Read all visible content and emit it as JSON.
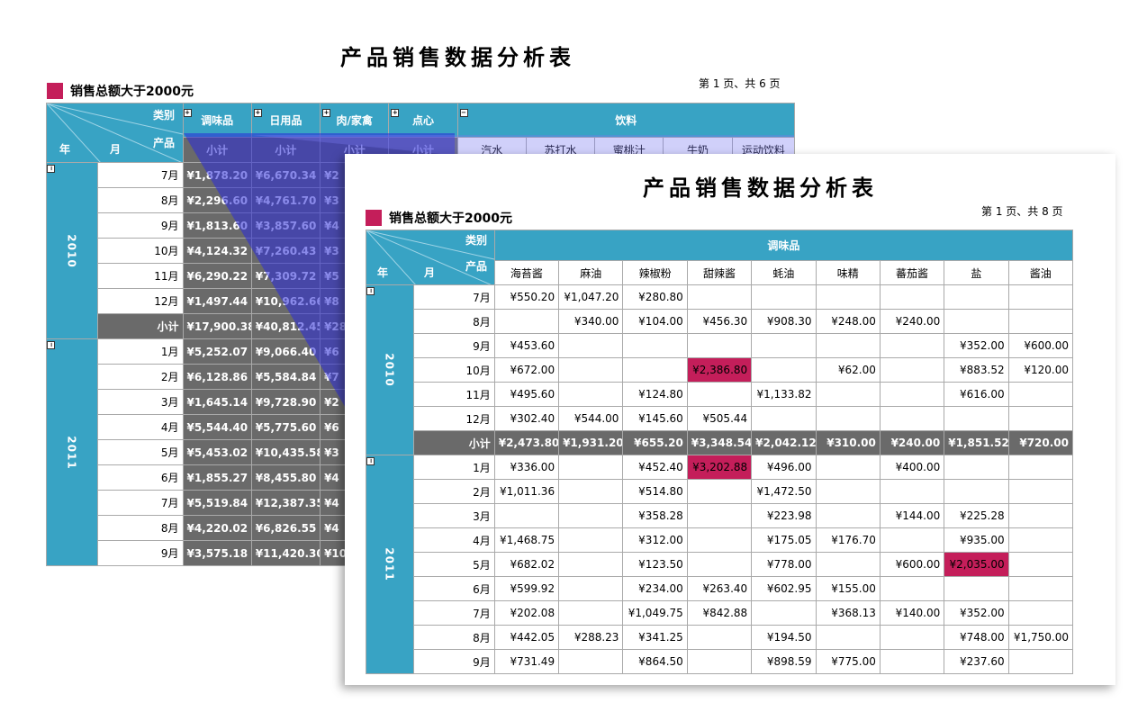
{
  "back": {
    "title": "产品销售数据分析表",
    "page_info": "第 1 页、共 6 页",
    "subtitle": "销售总额大于2000元",
    "corner": {
      "category": "类别",
      "product": "产品",
      "year": "年",
      "month": "月"
    },
    "categories": [
      "调味品",
      "日用品",
      "肉/家禽",
      "点心",
      "饮料"
    ],
    "subtotal_label": "小计",
    "drink_items": [
      "汽水",
      "苏打水",
      "蜜桃汁",
      "牛奶",
      "运动饮料"
    ],
    "years": [
      {
        "year": "2010",
        "rows": [
          {
            "month": "7月",
            "v1": "¥1,878.20",
            "v2": "¥6,670.34",
            "v3": "¥2"
          },
          {
            "month": "8月",
            "v1": "¥2,296.60",
            "v2": "¥4,761.70",
            "v3": "¥3"
          },
          {
            "month": "9月",
            "v1": "¥1,813.60",
            "v2": "¥3,857.60",
            "v3": "¥4"
          },
          {
            "month": "10月",
            "v1": "¥4,124.32",
            "v2": "¥7,260.43",
            "v3": "¥3"
          },
          {
            "month": "11月",
            "v1": "¥6,290.22",
            "v2": "¥7,309.72",
            "v3": "¥5"
          },
          {
            "month": "12月",
            "v1": "¥1,497.44",
            "v2": "¥10,962.66",
            "v3": "¥8"
          }
        ],
        "subtotal": {
          "label": "小计",
          "v1": "¥17,900.38",
          "v2": "¥40,812.45",
          "v3": "¥28"
        }
      },
      {
        "year": "2011",
        "rows": [
          {
            "month": "1月",
            "v1": "¥5,252.07",
            "v2": "¥9,066.40",
            "v3": "¥6"
          },
          {
            "month": "2月",
            "v1": "¥6,128.86",
            "v2": "¥5,584.84",
            "v3": "¥7"
          },
          {
            "month": "3月",
            "v1": "¥1,645.14",
            "v2": "¥9,728.90",
            "v3": "¥2"
          },
          {
            "month": "4月",
            "v1": "¥5,544.40",
            "v2": "¥5,775.60",
            "v3": "¥6"
          },
          {
            "month": "5月",
            "v1": "¥5,453.02",
            "v2": "¥10,435.58",
            "v3": "¥3"
          },
          {
            "month": "6月",
            "v1": "¥1,855.27",
            "v2": "¥8,455.80",
            "v3": "¥4"
          },
          {
            "month": "7月",
            "v1": "¥5,519.84",
            "v2": "¥12,387.35",
            "v3": "¥4"
          },
          {
            "month": "8月",
            "v1": "¥4,220.02",
            "v2": "¥6,826.55",
            "v3": "¥4"
          },
          {
            "month": "9月",
            "v1": "¥3,575.18",
            "v2": "¥11,420.30",
            "v3": "¥10"
          }
        ]
      }
    ]
  },
  "front": {
    "title": "产品销售数据分析表",
    "page_info": "第 1 页、共 8 页",
    "subtitle": "销售总额大于2000元",
    "corner": {
      "category": "类别",
      "product": "产品",
      "year": "年",
      "month": "月"
    },
    "category": "调味品",
    "products": [
      "海苔酱",
      "麻油",
      "辣椒粉",
      "甜辣酱",
      "蚝油",
      "味精",
      "蕃茄酱",
      "盐",
      "酱油"
    ],
    "years": [
      {
        "year": "2010",
        "rows": [
          {
            "month": "7月",
            "cells": [
              "¥550.20",
              "¥1,047.20",
              "¥280.80",
              "",
              "",
              "",
              "",
              "",
              ""
            ]
          },
          {
            "month": "8月",
            "cells": [
              "",
              "¥340.00",
              "¥104.00",
              "¥456.30",
              "¥908.30",
              "¥248.00",
              "¥240.00",
              "",
              ""
            ]
          },
          {
            "month": "9月",
            "cells": [
              "¥453.60",
              "",
              "",
              "",
              "",
              "",
              "",
              "¥352.00",
              "¥600.00"
            ]
          },
          {
            "month": "10月",
            "cells": [
              "¥672.00",
              "",
              "",
              "¥2,386.80",
              "",
              "¥62.00",
              "",
              "¥883.52",
              "¥120.00"
            ],
            "hl": [
              3
            ]
          },
          {
            "month": "11月",
            "cells": [
              "¥495.60",
              "",
              "¥124.80",
              "",
              "¥1,133.82",
              "",
              "",
              "¥616.00",
              ""
            ]
          },
          {
            "month": "12月",
            "cells": [
              "¥302.40",
              "¥544.00",
              "¥145.60",
              "¥505.44",
              "",
              "",
              "",
              "",
              ""
            ]
          }
        ],
        "subtotal": {
          "label": "小计",
          "cells": [
            "¥2,473.80",
            "¥1,931.20",
            "¥655.20",
            "¥3,348.54",
            "¥2,042.12",
            "¥310.00",
            "¥240.00",
            "¥1,851.52",
            "¥720.00"
          ]
        }
      },
      {
        "year": "2011",
        "rows": [
          {
            "month": "1月",
            "cells": [
              "¥336.00",
              "",
              "¥452.40",
              "¥3,202.88",
              "¥496.00",
              "",
              "¥400.00",
              "",
              ""
            ],
            "hl": [
              3
            ]
          },
          {
            "month": "2月",
            "cells": [
              "¥1,011.36",
              "",
              "¥514.80",
              "",
              "¥1,472.50",
              "",
              "",
              "",
              ""
            ]
          },
          {
            "month": "3月",
            "cells": [
              "",
              "",
              "¥358.28",
              "",
              "¥223.98",
              "",
              "¥144.00",
              "¥225.28",
              ""
            ]
          },
          {
            "month": "4月",
            "cells": [
              "¥1,468.75",
              "",
              "¥312.00",
              "",
              "¥175.05",
              "¥176.70",
              "",
              "¥935.00",
              ""
            ]
          },
          {
            "month": "5月",
            "cells": [
              "¥682.02",
              "",
              "¥123.50",
              "",
              "¥778.00",
              "",
              "¥600.00",
              "¥2,035.00",
              ""
            ],
            "hl": [
              7
            ]
          },
          {
            "month": "6月",
            "cells": [
              "¥599.92",
              "",
              "¥234.00",
              "¥263.40",
              "¥602.95",
              "¥155.00",
              "",
              "",
              ""
            ]
          },
          {
            "month": "7月",
            "cells": [
              "¥202.08",
              "",
              "¥1,049.75",
              "¥842.88",
              "",
              "¥368.13",
              "¥140.00",
              "¥352.00",
              ""
            ]
          },
          {
            "month": "8月",
            "cells": [
              "¥442.05",
              "¥288.23",
              "¥341.25",
              "",
              "¥194.50",
              "",
              "",
              "¥748.00",
              "¥1,750.00"
            ]
          },
          {
            "month": "9月",
            "cells": [
              "¥731.49",
              "",
              "¥864.50",
              "",
              "¥898.59",
              "¥775.00",
              "",
              "¥237.60",
              ""
            ]
          }
        ]
      }
    ]
  },
  "colors": {
    "teal": "#38a3c4",
    "gray": "#6a6a6a",
    "highlight": "#c41e5a",
    "drill_blue": "#2a2ad8"
  }
}
